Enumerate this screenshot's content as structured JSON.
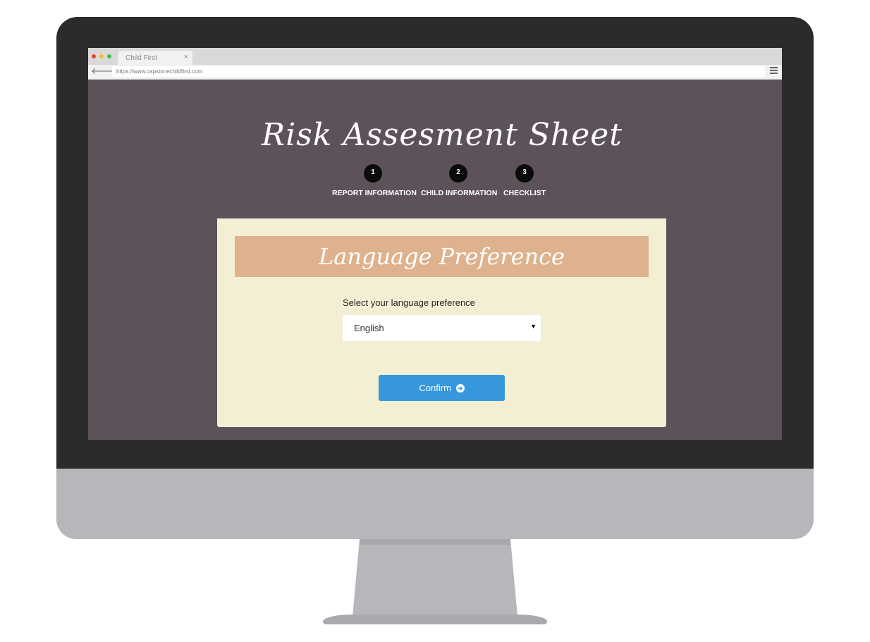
{
  "browser": {
    "tab_title": "Child First",
    "tab_close": "×",
    "url": "https://www.capstonechildfirst.com",
    "back_glyph": "🡐",
    "forward_glyph": "🡒",
    "icons": [
      "back-arrow-icon",
      "forward-arrow-icon",
      "close-icon",
      "menu-icon"
    ]
  },
  "page": {
    "title": "Risk Assesment Sheet",
    "steps": [
      {
        "number": "1",
        "label": "REPORT INFORMATION"
      },
      {
        "number": "2",
        "label": "CHILD INFORMATION"
      },
      {
        "number": "3",
        "label": "CHECKLIST"
      }
    ]
  },
  "card": {
    "heading": "Language Preference",
    "field_label": "Select your language preference",
    "language_select": {
      "selected": "English",
      "caret": "▼"
    },
    "confirm_label": "Confirm",
    "confirm_icon": "➜"
  },
  "colors": {
    "page_background": "#5e525a",
    "card_background": "#f4efd4",
    "header_band": "#ddb28d",
    "button": "#3697dd",
    "step_circle": "#0b0b0b"
  }
}
